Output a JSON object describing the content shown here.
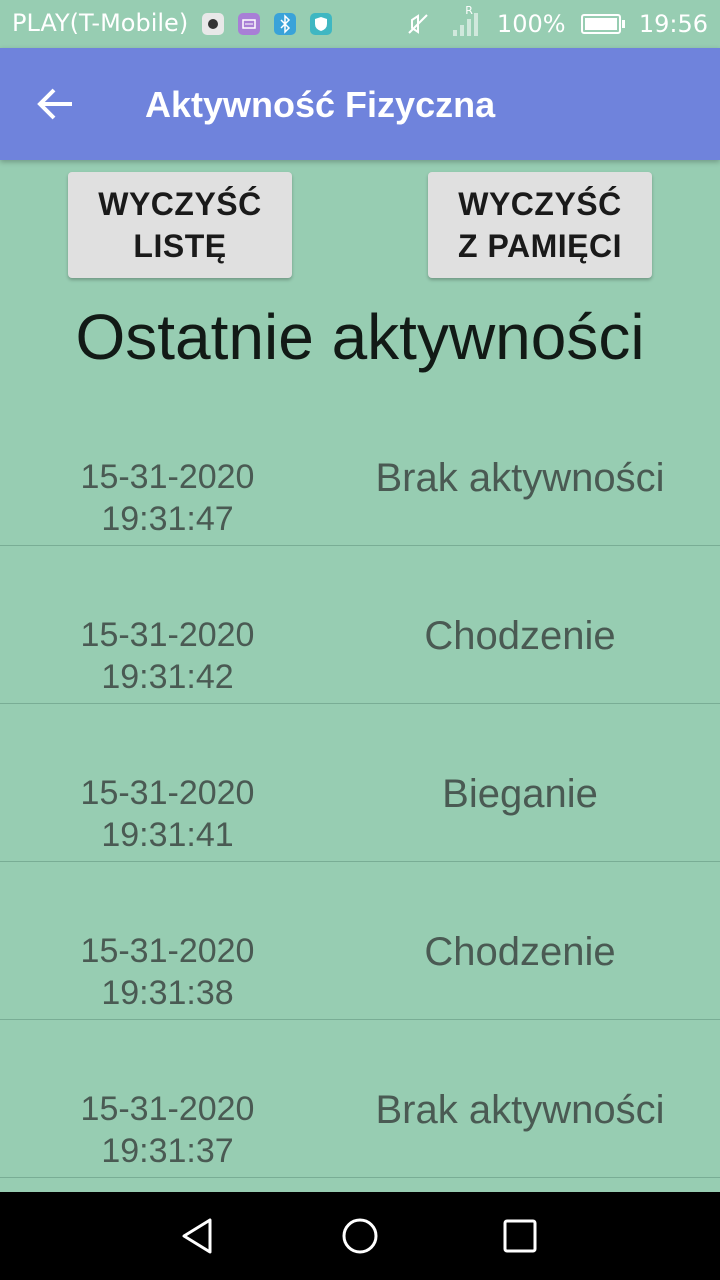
{
  "status_bar": {
    "carrier": "PLAY(T-Mobile)",
    "battery": "100%",
    "time": "19:56",
    "signal_roaming": "R",
    "icons": [
      "camera-icon",
      "messages-icon",
      "bluetooth-icon",
      "shield-icon",
      "mute-icon",
      "signal-icon",
      "battery-icon"
    ]
  },
  "app_bar": {
    "title": "Aktywność Fizyczna",
    "back_icon": "arrow-left-icon",
    "background_color": "#6f83dc"
  },
  "actions": {
    "clear_list": "WYCZYŚĆ\nLISTĘ",
    "clear_memory": "WYCZYŚĆ\nZ PAMIĘCI"
  },
  "section_title": "Ostatnie aktywności",
  "activities": [
    {
      "date": "15-31-2020",
      "time": "19:31:47",
      "activity": "Brak aktywności"
    },
    {
      "date": "15-31-2020",
      "time": "19:31:42",
      "activity": "Chodzenie"
    },
    {
      "date": "15-31-2020",
      "time": "19:31:41",
      "activity": "Bieganie"
    },
    {
      "date": "15-31-2020",
      "time": "19:31:38",
      "activity": "Chodzenie"
    },
    {
      "date": "15-31-2020",
      "time": "19:31:37",
      "activity": "Brak aktywności"
    }
  ],
  "nav_bar": {
    "icons": [
      "nav-back-icon",
      "nav-home-icon",
      "nav-recent-icon"
    ]
  },
  "colors": {
    "background": "#97cdb2",
    "app_bar": "#6f83dc",
    "button": "#e0e0e0",
    "text": "#4a5a53"
  }
}
